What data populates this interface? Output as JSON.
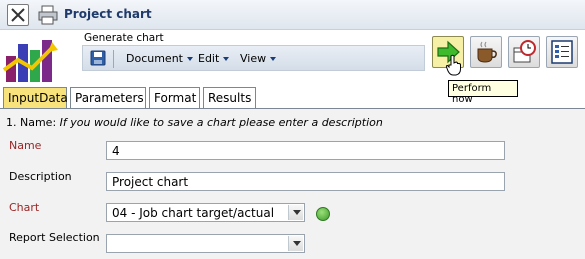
{
  "window": {
    "title": "Project chart"
  },
  "toolbar": {
    "title": "Generate chart",
    "menus": [
      "Document",
      "Edit",
      "View"
    ]
  },
  "tooltip": {
    "text": "Perform now"
  },
  "tabs": [
    {
      "label": "InputData",
      "active": true
    },
    {
      "label": "Parameters",
      "active": false
    },
    {
      "label": "Format",
      "active": false
    },
    {
      "label": "Results",
      "active": false
    }
  ],
  "form": {
    "hint_prefix": "1. Name:",
    "hint_text": "If you would like to save a chart please enter a description",
    "name": {
      "label": "Name",
      "value": "4"
    },
    "description": {
      "label": "Description",
      "value": "Project chart"
    },
    "chart": {
      "label": "Chart",
      "value": "04 - Job chart target/actual"
    },
    "report_selection": {
      "label": "Report Selection",
      "value": ""
    }
  },
  "colors": {
    "active_tab": "#f7e27b",
    "required_label": "#9a2525",
    "title_text": "#1f3a6b",
    "tooltip_bg": "#ffffe1"
  },
  "icons": [
    "close-icon",
    "print-icon",
    "app-logo",
    "save-icon",
    "perform-now-icon",
    "coffee-icon",
    "schedule-icon",
    "report-icon",
    "ok-icon",
    "hand-cursor-icon"
  ]
}
